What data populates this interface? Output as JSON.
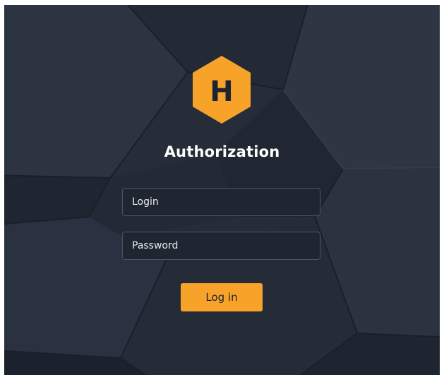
{
  "app": {
    "logo_letter": "H",
    "logo_icon": "hexagon-logo-icon",
    "title": "Authorization"
  },
  "form": {
    "login_placeholder": "Login",
    "password_placeholder": "Password",
    "submit_label": "Log in"
  },
  "colors": {
    "accent": "#f7a32a",
    "background": "#262d39",
    "field_background": "#1f2632",
    "field_border": "#4d5564",
    "text": "#ffffff"
  }
}
